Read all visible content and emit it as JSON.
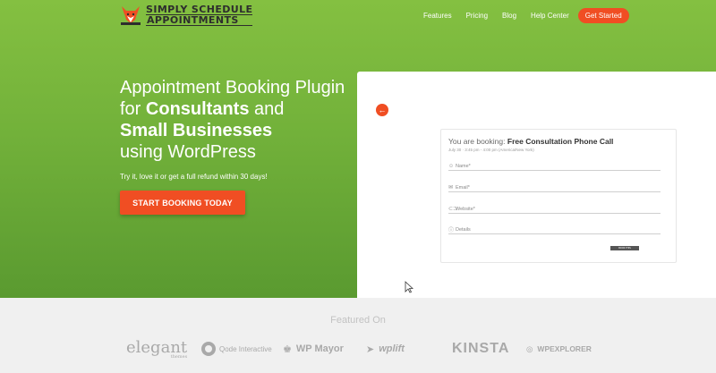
{
  "header": {
    "logo_line1": "SIMPLY SCHEDULE",
    "logo_line2": "APPOINTMENTS",
    "nav": [
      "Features",
      "Pricing",
      "Blog",
      "Help Center"
    ],
    "cta": "Get Started"
  },
  "hero": {
    "line1": "Appointment Booking Plugin",
    "line2_pre": "for ",
    "line2_bold": "Consultants",
    "line2_post": " and",
    "line3_bold": "Small Businesses",
    "line4": "using WordPress",
    "subtext": "Try it, love it or get a full refund within 30 days!",
    "cta": "START BOOKING TODAY"
  },
  "preview": {
    "back_icon": "arrow-left-icon",
    "booking_prefix": "You are booking:",
    "booking_name": "Free Consultation Phone Call",
    "booking_time": "July 30  ·  3:45 pm - 4:00 pm (America/New York)",
    "fields": [
      {
        "icon": "user-icon",
        "glyph": "☺",
        "label": "Name*"
      },
      {
        "icon": "email-icon",
        "glyph": "✉",
        "label": "Email*"
      },
      {
        "icon": "link-icon",
        "glyph": "⊂⊃",
        "label": "Website*"
      },
      {
        "icon": "info-icon",
        "glyph": "ⓘ",
        "label": "Details"
      }
    ],
    "submit": "BOOK THIS APPOINTMENT"
  },
  "featured": {
    "title": "Featured On",
    "brands": {
      "elegant": "elegant",
      "elegant_sub": "themes",
      "qode": "Qode Interactive",
      "wpmayor": "WP Mayor",
      "wplift": "wplift",
      "kinsta": "KINSTA",
      "wpexplorer": "WPEXPLORER"
    }
  },
  "colors": {
    "hero_green": "#78b83e",
    "accent_orange": "#f04e23",
    "footer_bg": "#f0f0f0"
  }
}
